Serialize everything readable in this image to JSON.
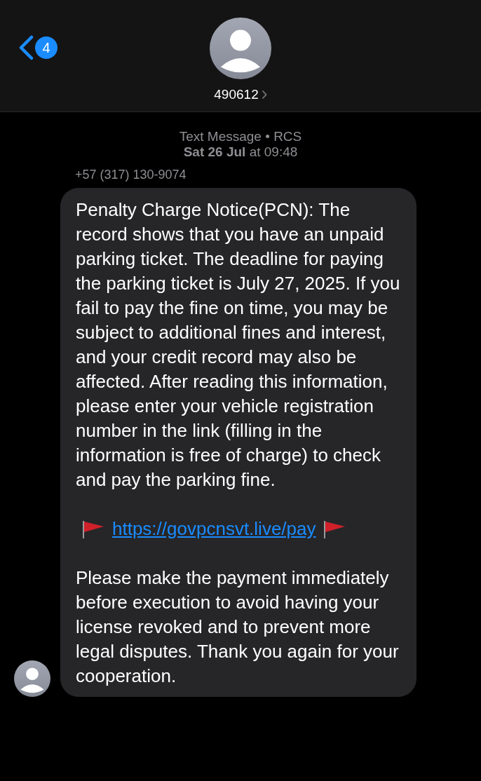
{
  "header": {
    "back_badge": "4",
    "contact_name": "490612"
  },
  "meta": {
    "service": "Text Message • RCS",
    "timestamp": "**Sat 26 Jul** at 09:48"
  },
  "sender": "+57 (317) 130-9074",
  "message": {
    "paragraphs": [
      "Penalty Charge Notice(PCN): The record shows that you have an unpaid parking ticket. The deadline for paying the parking ticket is July 27, 2025. If you fail to pay the fine on time, you may be subject to additional fines and interest, and your credit record may also be affected. After reading this information, please enter your vehicle registration number in the link (filling in the information is free of charge) to check and pay the parking fine.",
      "Please make the payment immediately before execution to avoid having your license revoked and to prevent more legal disputes. Thank you again for your cooperation."
    ],
    "link": "https://govpcnsvt.live/pay"
  }
}
